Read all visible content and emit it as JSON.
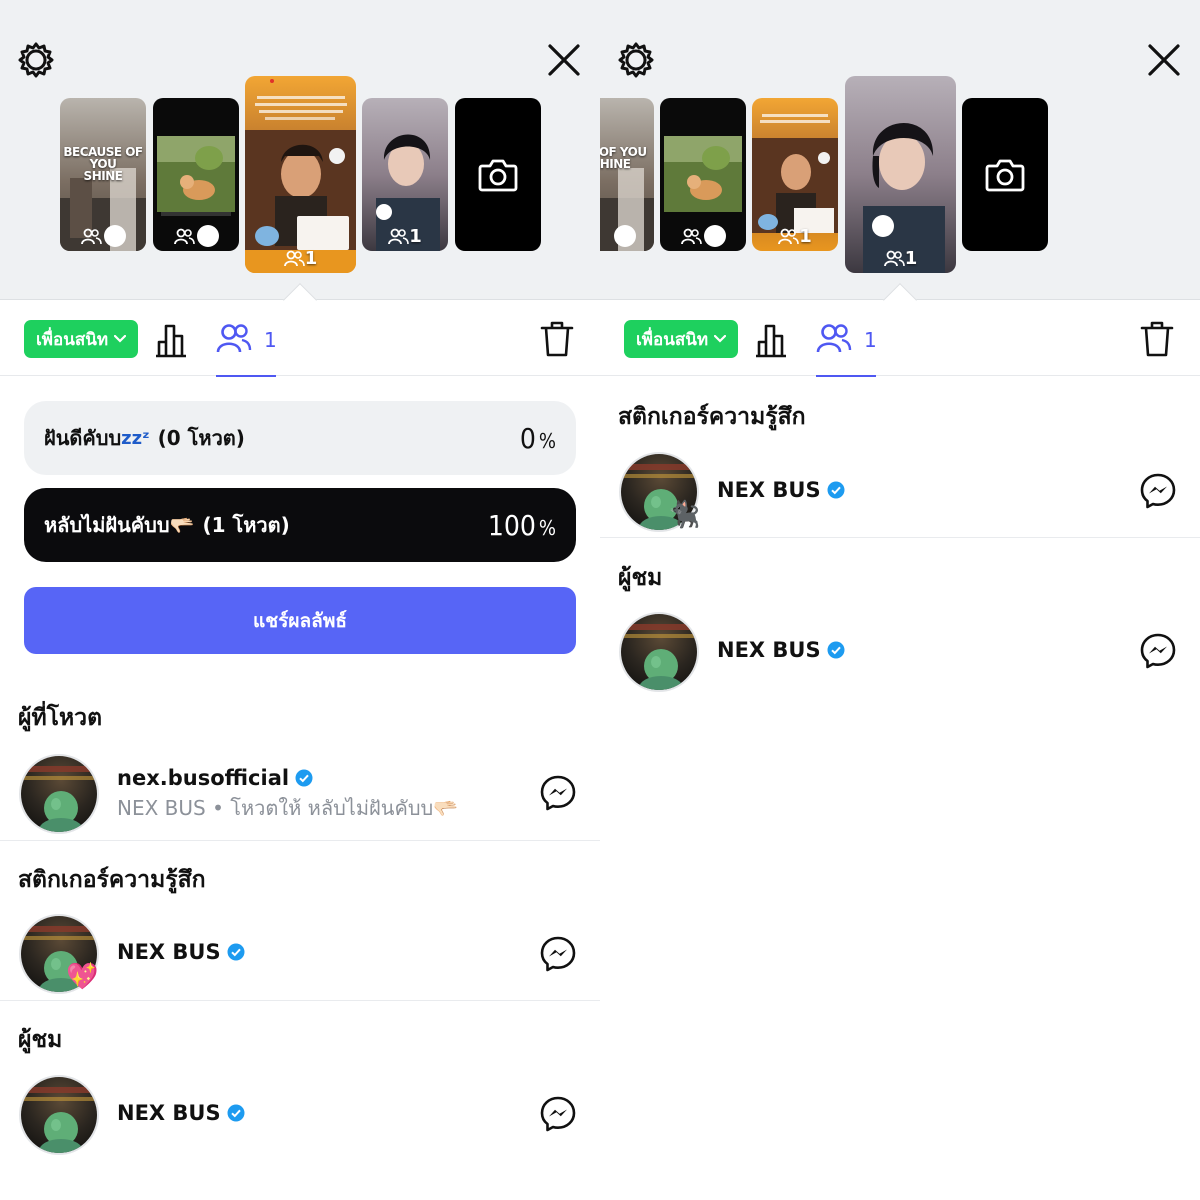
{
  "colors": {
    "accent": "#4f58f2",
    "share_button": "#5765f6",
    "audience_pill": "#1ed05e",
    "verified": "#1d9bf0",
    "winning_option": "#0b0b0d",
    "losing_option": "#eff1f3"
  },
  "icons": {
    "settings": "gear-icon",
    "close": "close-icon",
    "stats": "bar-chart-icon",
    "viewers": "people-icon",
    "delete": "trash-icon",
    "message": "messenger-icon",
    "verified": "verified-badge-icon",
    "camera": "camera-icon"
  },
  "left": {
    "thumbnails": [
      {
        "kind": "story",
        "overlay_line1": "BECAUSE OF YOU",
        "overlay_line2": "SHINE",
        "count": ""
      },
      {
        "kind": "story",
        "count": ""
      },
      {
        "kind": "story",
        "count": "1",
        "selected": true
      },
      {
        "kind": "story",
        "count": "1"
      },
      {
        "kind": "add-story"
      }
    ],
    "toolbar": {
      "audience": "เพื่อนสนิท",
      "viewer_count": "1"
    },
    "poll": {
      "options": [
        {
          "label": "ฝันดีคับบ",
          "suffix": "zzᶻ",
          "votes": "(0 โหวต)",
          "percent": "0",
          "percent_sign": "%",
          "winner": false
        },
        {
          "label": "หลับไม่ฝันคับบ🫳🏻",
          "votes": "(1 โหวต)",
          "percent": "100",
          "percent_sign": "%",
          "winner": true
        }
      ],
      "share_label": "แชร์ผลลัพธ์"
    },
    "sections": {
      "voters_title": "ผู้ที่โหวต",
      "voter": {
        "name": "nex.busofficial",
        "subtitle": "NEX BUS • โหวตให้ หลับไม่ฝันคับบ🫳🏻"
      },
      "reactions_title": "สติกเกอร์ความรู้สึก",
      "reaction": {
        "name": "NEX BUS",
        "sticker": "💖"
      },
      "viewers_title": "ผู้ชม",
      "viewer": {
        "name": "NEX BUS"
      }
    }
  },
  "right": {
    "thumbnails": [
      {
        "kind": "story",
        "overlay_line1": "ISE OF YOU",
        "overlay_line2": "SHINE",
        "count": ""
      },
      {
        "kind": "story",
        "count": ""
      },
      {
        "kind": "story",
        "count": "1"
      },
      {
        "kind": "story",
        "count": "1",
        "selected": true
      },
      {
        "kind": "add-story"
      }
    ],
    "toolbar": {
      "audience": "เพื่อนสนิท",
      "viewer_count": "1"
    },
    "sections": {
      "reactions_title": "สติกเกอร์ความรู้สึก",
      "reaction": {
        "name": "NEX BUS",
        "sticker": "🐈‍⬛"
      },
      "viewers_title": "ผู้ชม",
      "viewer": {
        "name": "NEX BUS"
      }
    }
  }
}
